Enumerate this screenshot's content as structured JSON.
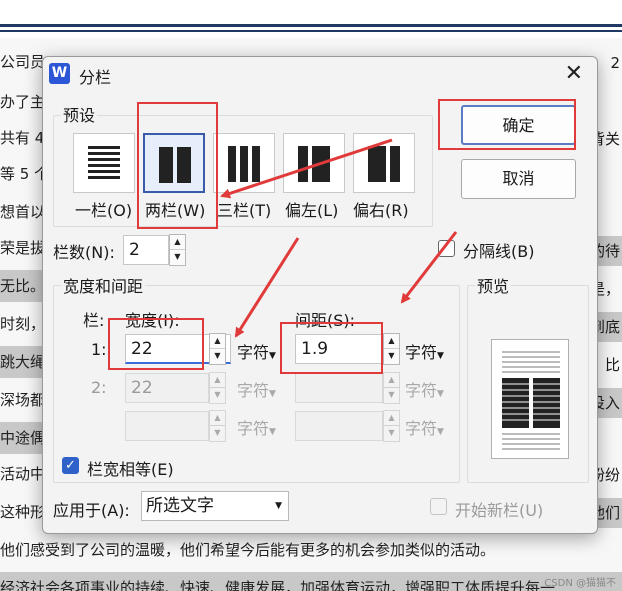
{
  "background": {
    "lines": [
      "公司员",
      "办了主",
      "共有 44",
      "等 5 个",
      "想首以",
      "荣是拔",
      "无比。",
      "时刻，",
      "跳大绳",
      "深场都",
      "中途偶",
      "活动中",
      "这种形",
      "他们感受到了公司的温暖，他们希望今后能有更多的机会参加类似的活动。",
      "经济社会各项事业的持续、快速、健康发展，加强体育运动，增强职工体质提升每一"
    ],
    "right_lines": [
      "2",
      "背关",
      "的待",
      "是，",
      "到底",
      "。比",
      "投入",
      "纷纷",
      "他们"
    ],
    "watermark": "CSDN @猫猫不"
  },
  "dialog": {
    "logo": "W",
    "title": "分栏",
    "close_icon": "close-icon",
    "presets_label": "预设",
    "presets": [
      {
        "label": "一栏(O)",
        "icon": "one-column-icon"
      },
      {
        "label": "两栏(W)",
        "icon": "two-column-icon",
        "selected": true
      },
      {
        "label": "三栏(T)",
        "icon": "three-column-icon"
      },
      {
        "label": "偏左(L)",
        "icon": "left-column-icon"
      },
      {
        "label": "偏右(R)",
        "icon": "right-column-icon"
      }
    ],
    "ok": "确定",
    "cancel": "取消",
    "columns_label": "栏数(N):",
    "columns_value": "2",
    "separator_label": "分隔线(B)",
    "width_spacing_label": "宽度和间距",
    "col_header": "栏:",
    "width_header": "宽度(I):",
    "spacing_header": "间距(S):",
    "rows": [
      {
        "num": "1:",
        "width": "22",
        "unit": "字符",
        "spacing": "1.9",
        "spacing_unit": "字符"
      },
      {
        "num": "2:",
        "width": "22",
        "unit": "字符",
        "spacing": "",
        "spacing_unit": "字符"
      },
      {
        "num": "",
        "width": "",
        "unit": "字符",
        "spacing": "",
        "spacing_unit": "字符"
      }
    ],
    "equal_width_label": "栏宽相等(E)",
    "preview_label": "预览",
    "apply_label": "应用于(A):",
    "apply_value": "所选文字",
    "new_column_label": "开始新栏(U)"
  },
  "colors": {
    "accent": "#2f62c9",
    "annotation": "#e03a3a"
  }
}
